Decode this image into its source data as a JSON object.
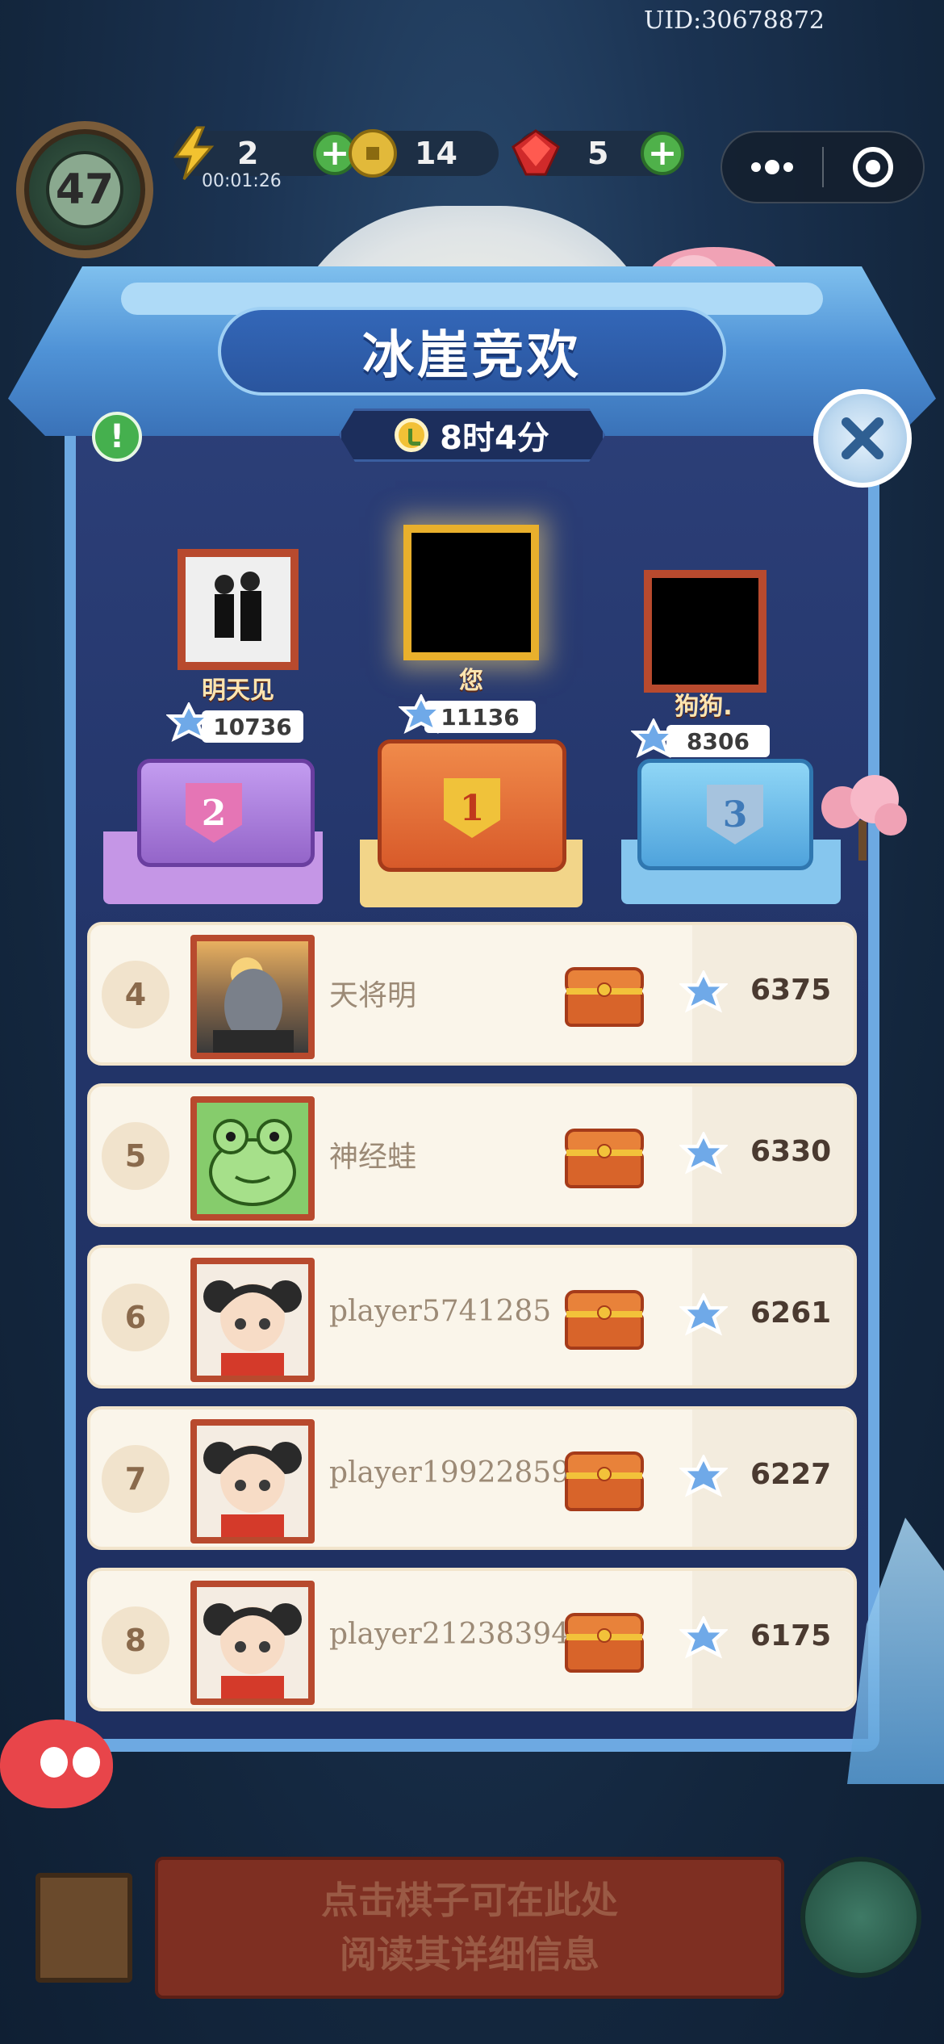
{
  "uid": "UID:30678872",
  "hud": {
    "level": "47",
    "energy": "2",
    "energy_timer": "00:01:26",
    "coins": "14",
    "gems": "5"
  },
  "event": {
    "title": "冰崖竞欢",
    "time_left": "8时4分"
  },
  "podium": [
    {
      "rank": "2",
      "name": "明天见",
      "score": "10736"
    },
    {
      "rank": "1",
      "name": "您",
      "score": "11136"
    },
    {
      "rank": "3",
      "name": "狗狗.",
      "score": "8306"
    }
  ],
  "leaderboard": [
    {
      "rank": "4",
      "name": "天将明",
      "score": "6375"
    },
    {
      "rank": "5",
      "name": "神经蛙",
      "score": "6330"
    },
    {
      "rank": "6",
      "name": "player5741285",
      "score": "6261"
    },
    {
      "rank": "7",
      "name": "player19922859",
      "score": "6227"
    },
    {
      "rank": "8",
      "name": "player21238394",
      "score": "6175"
    }
  ],
  "bottom_hint": {
    "line1": "点击棋子可在此处",
    "line2": "阅读其详细信息"
  },
  "colors": {
    "gold": "#e9b02c",
    "purple": "#a77ed6",
    "blue": "#7cc3ee",
    "frame_red": "#b84a2e",
    "plus_green": "#4fb14a"
  }
}
